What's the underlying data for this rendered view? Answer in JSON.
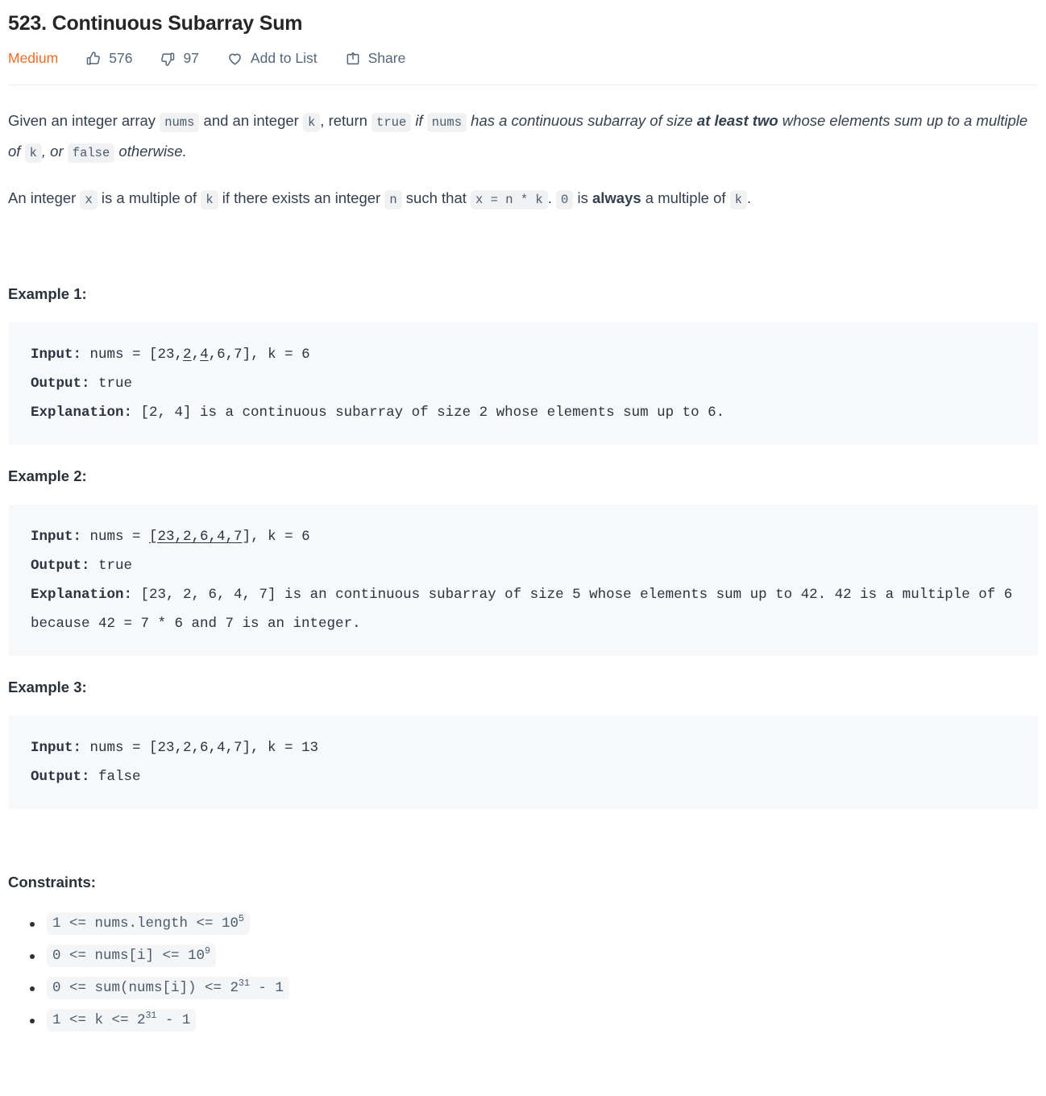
{
  "header": {
    "title": "523. Continuous Subarray Sum",
    "difficulty": "Medium",
    "likes": "576",
    "dislikes": "97",
    "add_to_list_label": "Add to List",
    "share_label": "Share",
    "accent_color": "#ef6c26",
    "meta_text_color": "#54667a"
  },
  "description": {
    "p1": {
      "t1": "Given an integer array ",
      "c1": "nums",
      "t2": " and an integer ",
      "c2": "k",
      "t3": ", return ",
      "c3": "true",
      "t4": " if ",
      "c4": "nums",
      "t5": " has a continuous subarray of size ",
      "b1": "at least two",
      "t6": " whose elements sum up to a multiple of ",
      "c5": "k",
      "t7": ", or ",
      "c6": "false",
      "t8": " otherwise."
    },
    "p2": {
      "t1": "An integer ",
      "c1": "x",
      "t2": " is a multiple of ",
      "c2": "k",
      "t3": " if there exists an integer ",
      "c3": "n",
      "t4": " such that ",
      "c4": "x = n * k",
      "t5": ". ",
      "c5": "0",
      "t6": " is ",
      "b1": "always",
      "t7": " a multiple of ",
      "c6": "k",
      "t8": "."
    }
  },
  "examples": [
    {
      "heading": "Example 1:",
      "input_label": "Input:",
      "input_pre": " nums = [23,",
      "input_underlined": [
        "2",
        "4"
      ],
      "input_post": ",6,7], k = 6",
      "output_label": "Output:",
      "output_value": " true",
      "explanation_label": "Explanation:",
      "explanation_value": " [2, 4] is a continuous subarray of size 2 whose elements sum up to 6."
    },
    {
      "heading": "Example 2:",
      "input_label": "Input:",
      "input_pre": " nums = ",
      "input_underlined_full": "[23,2,6,4,7",
      "input_post": "], k = 6",
      "output_label": "Output:",
      "output_value": " true",
      "explanation_label": "Explanation:",
      "explanation_value": " [23, 2, 6, 4, 7] is an continuous subarray of size 5 whose elements sum up to 42. 42 is a multiple of 6 because 42 = 7 * 6 and 7 is an integer."
    },
    {
      "heading": "Example 3:",
      "input_label": "Input:",
      "input_value": " nums = [23,2,6,4,7], k = 13",
      "output_label": "Output:",
      "output_value": " false"
    }
  ],
  "constraints": {
    "heading": "Constraints:",
    "items": [
      {
        "base": "1 <= nums.length <= 10",
        "exp": "5",
        "tail": ""
      },
      {
        "base": "0 <= nums[i] <= 10",
        "exp": "9",
        "tail": ""
      },
      {
        "base": "0 <= sum(nums[i]) <= 2",
        "exp": "31",
        "tail": " - 1"
      },
      {
        "base": "1 <= k <= 2",
        "exp": "31",
        "tail": " - 1"
      }
    ]
  }
}
